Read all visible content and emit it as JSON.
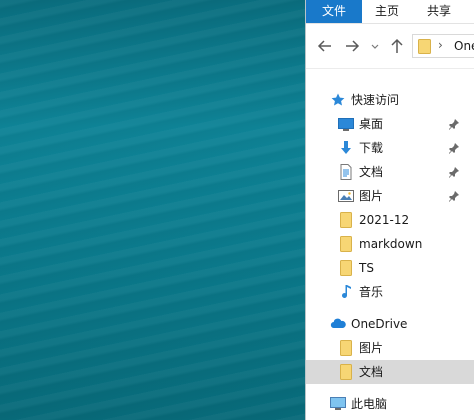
{
  "ribbon": {
    "tabs": [
      "文件",
      "主页",
      "共享"
    ]
  },
  "address": {
    "path_text": "OneDrive"
  },
  "tree": {
    "quick_access": "快速访问",
    "quick_items": [
      {
        "label": "桌面",
        "icon": "desktop-icon",
        "pinned": true
      },
      {
        "label": "下载",
        "icon": "download-icon",
        "pinned": true
      },
      {
        "label": "文档",
        "icon": "document-icon",
        "pinned": true
      },
      {
        "label": "图片",
        "icon": "pictures-icon",
        "pinned": true
      },
      {
        "label": "2021-12",
        "icon": "folder-icon",
        "pinned": false
      },
      {
        "label": "markdown",
        "icon": "folder-icon",
        "pinned": false
      },
      {
        "label": "TS",
        "icon": "folder-icon",
        "pinned": false
      },
      {
        "label": "音乐",
        "icon": "music-icon",
        "pinned": false
      }
    ],
    "onedrive": "OneDrive",
    "onedrive_items": [
      {
        "label": "图片",
        "icon": "folder-icon",
        "selected": false
      },
      {
        "label": "文档",
        "icon": "folder-icon",
        "selected": true
      }
    ],
    "this_pc": "此电脑"
  },
  "colors": {
    "file_tab": "#1979ca",
    "selection": "#d9d9d9",
    "folder": "#f7d674",
    "accent_blue": "#1f7fd6"
  }
}
